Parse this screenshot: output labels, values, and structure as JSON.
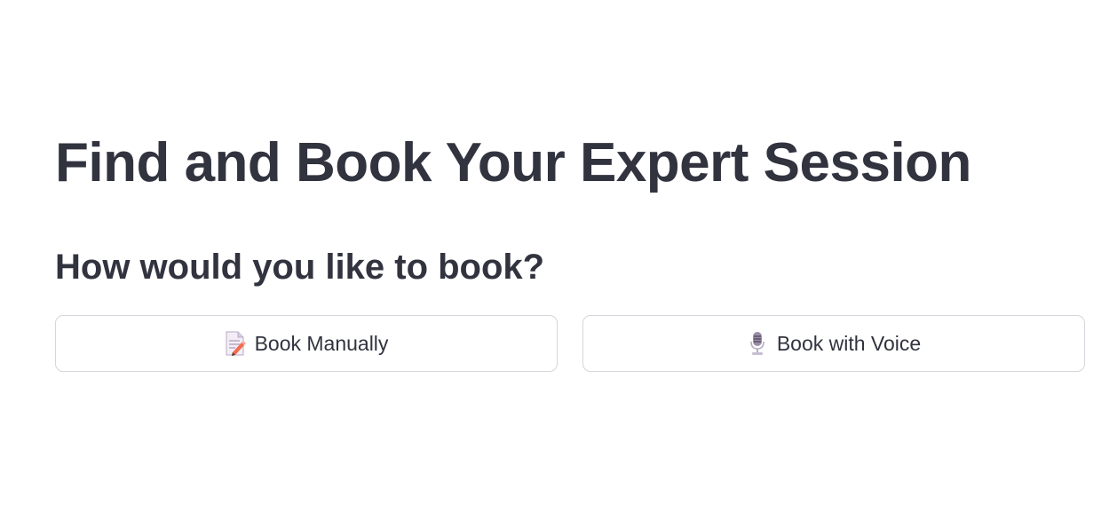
{
  "main": {
    "title": "Find and Book Your Expert Session",
    "subtitle": "How would you like to book?",
    "buttons": [
      {
        "label": "Book Manually",
        "icon": "memo-pencil-icon"
      },
      {
        "label": "Book with Voice",
        "icon": "studio-microphone-icon"
      }
    ]
  },
  "colors": {
    "text": "#31333f",
    "button_border": "#d5d6db",
    "background": "#ffffff"
  }
}
